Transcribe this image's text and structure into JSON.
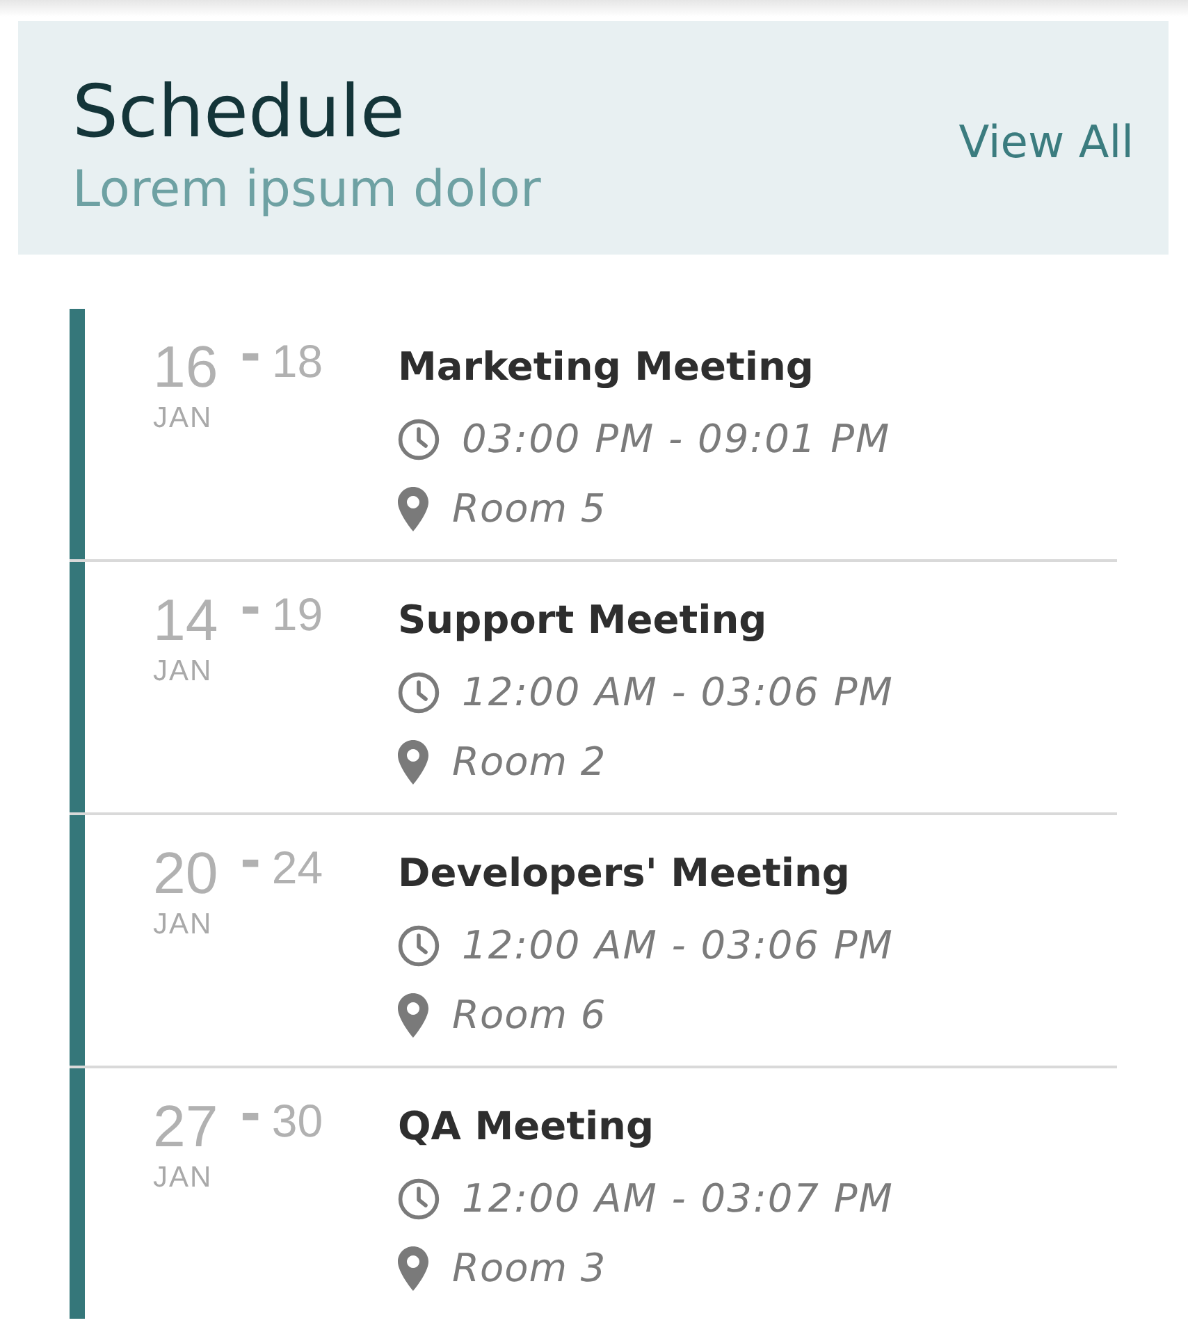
{
  "header": {
    "title": "Schedule",
    "subtitle": "Lorem ipsum dolor",
    "link": "View All"
  },
  "events": [
    {
      "start_day": "16",
      "separator": "-",
      "end_day": "18",
      "month": "JAN",
      "title": "Marketing Meeting",
      "time": "03:00 PM - 09:01 PM",
      "location": "Room 5"
    },
    {
      "start_day": "14",
      "separator": "-",
      "end_day": "19",
      "month": "JAN",
      "title": "Support Meeting",
      "time": "12:00 AM - 03:06 PM",
      "location": "Room 2"
    },
    {
      "start_day": "20",
      "separator": "-",
      "end_day": "24",
      "month": "JAN",
      "title": "Developers' Meeting",
      "time": "12:00 AM - 03:06 PM",
      "location": "Room 6"
    },
    {
      "start_day": "27",
      "separator": "-",
      "end_day": "30",
      "month": "JAN",
      "title": "QA Meeting",
      "time": "12:00 AM - 03:07 PM",
      "location": "Room 3"
    }
  ]
}
